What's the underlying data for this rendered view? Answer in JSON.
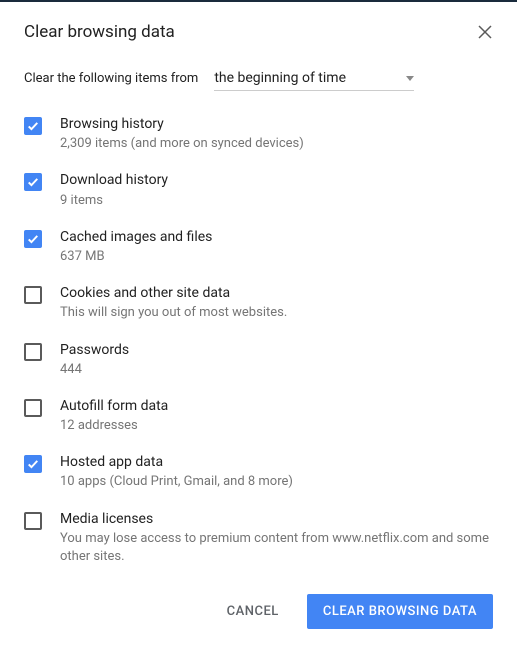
{
  "dialog": {
    "title": "Clear browsing data",
    "range_label": "Clear the following items from",
    "range_value": "the beginning of time",
    "items": [
      {
        "checked": true,
        "title": "Browsing history",
        "desc": "2,309 items (and more on synced devices)"
      },
      {
        "checked": true,
        "title": "Download history",
        "desc": "9 items"
      },
      {
        "checked": true,
        "title": "Cached images and files",
        "desc": "637 MB"
      },
      {
        "checked": false,
        "title": "Cookies and other site data",
        "desc": "This will sign you out of most websites."
      },
      {
        "checked": false,
        "title": "Passwords",
        "desc": "444"
      },
      {
        "checked": false,
        "title": "Autofill form data",
        "desc": "12 addresses"
      },
      {
        "checked": true,
        "title": "Hosted app data",
        "desc": "10 apps (Cloud Print, Gmail, and 8 more)"
      },
      {
        "checked": false,
        "title": "Media licenses",
        "desc": "You may lose access to premium content from www.netflix.com and some other sites."
      }
    ],
    "cancel_label": "CANCEL",
    "confirm_label": "CLEAR BROWSING DATA"
  }
}
